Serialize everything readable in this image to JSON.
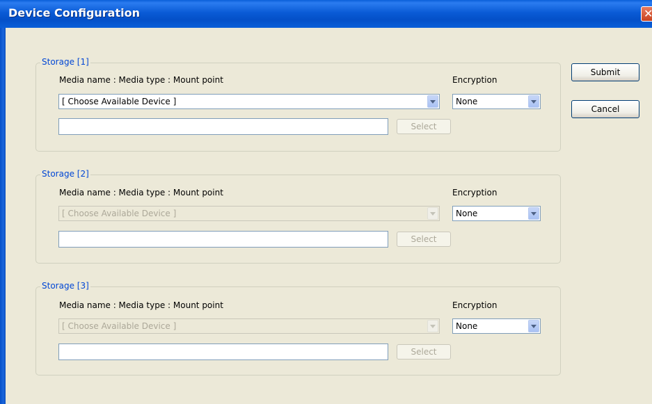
{
  "window": {
    "title": "Device Configuration"
  },
  "buttons": {
    "submit": "Submit",
    "cancel": "Cancel"
  },
  "storage": [
    {
      "legend": "Storage [1]",
      "media_label": "Media name : Media type : Mount point",
      "encryption_label": "Encryption",
      "device_value": "[ Choose Available Device ]",
      "device_enabled": true,
      "encryption_value": "None",
      "path_value": "",
      "select_label": "Select"
    },
    {
      "legend": "Storage [2]",
      "media_label": "Media name : Media type : Mount point",
      "encryption_label": "Encryption",
      "device_value": "[ Choose Available Device ]",
      "device_enabled": false,
      "encryption_value": "None",
      "path_value": "",
      "select_label": "Select"
    },
    {
      "legend": "Storage [3]",
      "media_label": "Media name : Media type : Mount point",
      "encryption_label": "Encryption",
      "device_value": "[ Choose Available Device ]",
      "device_enabled": false,
      "encryption_value": "None",
      "path_value": "",
      "select_label": "Select"
    }
  ],
  "colors": {
    "titlebar": "#0a5bd6",
    "legend_text": "#0046d5",
    "dialog_bg": "#ece9d8",
    "close_button": "#c8421f"
  },
  "icons": {
    "close": "close-icon",
    "dropdown": "chevron-down-icon"
  }
}
